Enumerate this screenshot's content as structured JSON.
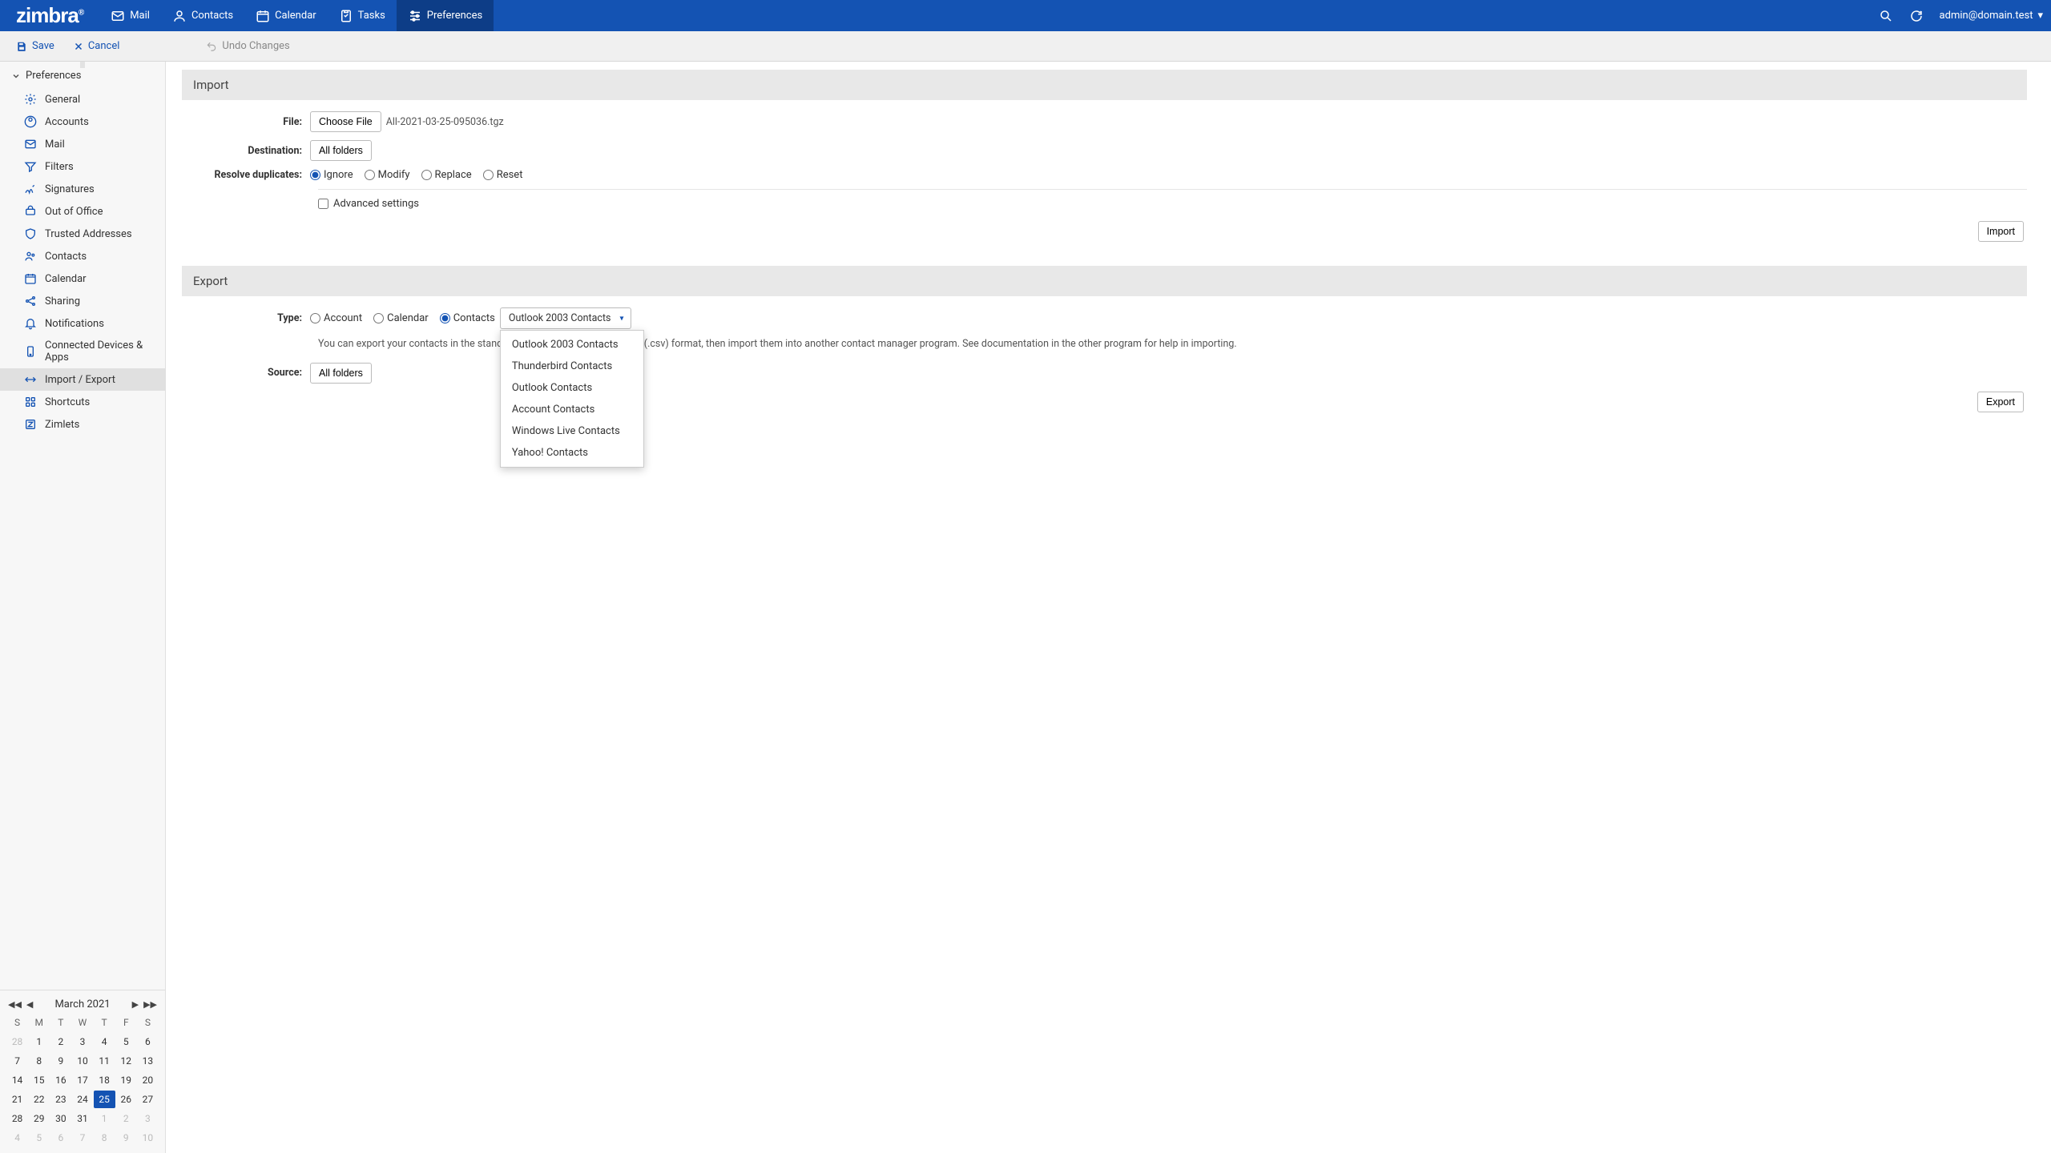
{
  "brand": "zimbra",
  "topnav": {
    "tabs": [
      {
        "label": "Mail",
        "icon": "mail-icon"
      },
      {
        "label": "Contacts",
        "icon": "contacts-icon"
      },
      {
        "label": "Calendar",
        "icon": "calendar-icon"
      },
      {
        "label": "Tasks",
        "icon": "tasks-icon"
      },
      {
        "label": "Preferences",
        "icon": "preferences-icon",
        "active": true
      }
    ],
    "user": "admin@domain.test"
  },
  "actionbar": {
    "save": "Save",
    "cancel": "Cancel",
    "undo": "Undo Changes"
  },
  "sidebar": {
    "header": "Preferences",
    "items": [
      {
        "label": "General",
        "icon": "gear-icon"
      },
      {
        "label": "Accounts",
        "icon": "accounts-icon"
      },
      {
        "label": "Mail",
        "icon": "mail-icon"
      },
      {
        "label": "Filters",
        "icon": "filter-icon"
      },
      {
        "label": "Signatures",
        "icon": "signature-icon"
      },
      {
        "label": "Out of Office",
        "icon": "ooo-icon"
      },
      {
        "label": "Trusted Addresses",
        "icon": "shield-icon"
      },
      {
        "label": "Contacts",
        "icon": "contacts-icon"
      },
      {
        "label": "Calendar",
        "icon": "calendar-icon"
      },
      {
        "label": "Sharing",
        "icon": "share-icon"
      },
      {
        "label": "Notifications",
        "icon": "bell-icon"
      },
      {
        "label": "Connected Devices & Apps",
        "icon": "device-icon"
      },
      {
        "label": "Import / Export",
        "icon": "importexport-icon",
        "active": true
      },
      {
        "label": "Shortcuts",
        "icon": "shortcut-icon"
      },
      {
        "label": "Zimlets",
        "icon": "zimlet-icon"
      }
    ]
  },
  "import": {
    "title": "Import",
    "file_label": "File:",
    "choose_file": "Choose File",
    "file_name": "All-2021-03-25-095036.tgz",
    "destination_label": "Destination:",
    "destination_value": "All folders",
    "resolve_label": "Resolve duplicates:",
    "resolve_options": [
      "Ignore",
      "Modify",
      "Replace",
      "Reset"
    ],
    "resolve_selected": "Ignore",
    "advanced": "Advanced settings",
    "button": "Import"
  },
  "export": {
    "title": "Export",
    "type_label": "Type:",
    "type_options": [
      "Account",
      "Calendar",
      "Contacts"
    ],
    "type_selected": "Contacts",
    "format_selected": "Outlook 2003 Contacts",
    "format_options": [
      "Outlook 2003 Contacts",
      "Thunderbird Contacts",
      "Outlook Contacts",
      "Account Contacts",
      "Windows Live Contacts",
      "Yahoo! Contacts"
    ],
    "hint": "You can export your contacts in the standard \"Comma-Separated Values\" (.csv) format, then import them into another contact manager program. See documentation in the other program for help in importing.",
    "source_label": "Source:",
    "source_value": "All folders",
    "button": "Export"
  },
  "minical": {
    "title": "March 2021",
    "dow": [
      "S",
      "M",
      "T",
      "W",
      "T",
      "F",
      "S"
    ],
    "weeks": [
      [
        {
          "d": "28",
          "o": true
        },
        {
          "d": "1"
        },
        {
          "d": "2"
        },
        {
          "d": "3"
        },
        {
          "d": "4"
        },
        {
          "d": "5"
        },
        {
          "d": "6"
        }
      ],
      [
        {
          "d": "7"
        },
        {
          "d": "8"
        },
        {
          "d": "9"
        },
        {
          "d": "10"
        },
        {
          "d": "11"
        },
        {
          "d": "12"
        },
        {
          "d": "13"
        }
      ],
      [
        {
          "d": "14"
        },
        {
          "d": "15"
        },
        {
          "d": "16"
        },
        {
          "d": "17"
        },
        {
          "d": "18"
        },
        {
          "d": "19"
        },
        {
          "d": "20"
        }
      ],
      [
        {
          "d": "21"
        },
        {
          "d": "22"
        },
        {
          "d": "23"
        },
        {
          "d": "24"
        },
        {
          "d": "25",
          "t": true
        },
        {
          "d": "26"
        },
        {
          "d": "27"
        }
      ],
      [
        {
          "d": "28"
        },
        {
          "d": "29"
        },
        {
          "d": "30"
        },
        {
          "d": "31"
        },
        {
          "d": "1",
          "o": true
        },
        {
          "d": "2",
          "o": true
        },
        {
          "d": "3",
          "o": true
        }
      ],
      [
        {
          "d": "4",
          "o": true
        },
        {
          "d": "5",
          "o": true
        },
        {
          "d": "6",
          "o": true
        },
        {
          "d": "7",
          "o": true
        },
        {
          "d": "8",
          "o": true
        },
        {
          "d": "9",
          "o": true
        },
        {
          "d": "10",
          "o": true
        }
      ]
    ]
  },
  "colors": {
    "primary": "#1453b3"
  }
}
